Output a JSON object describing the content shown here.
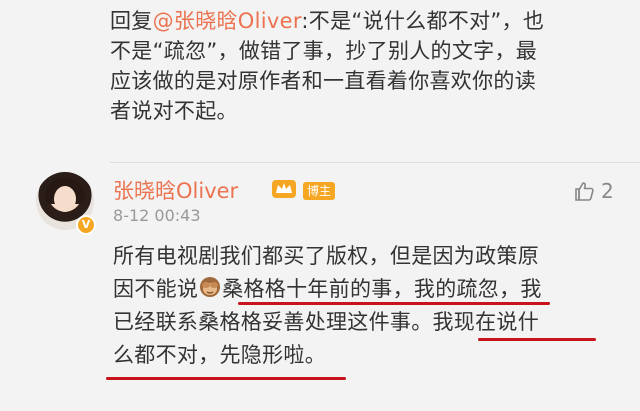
{
  "reply": {
    "prefix": "回复",
    "mention": "@张晓晗Oliver",
    "lines": [
      ":不是“说什么都不对”，也",
      "不是“疏忽”，做错了事，抄了别人的文字，最",
      "应该做的是对原作者和一直看着你喜欢你的读",
      "者说对不起。"
    ]
  },
  "comment": {
    "username": "张晓晗Oliver",
    "role_badge": "博主",
    "timestamp": "8-12 00:43",
    "like_count": "2",
    "lines": [
      "所有电视剧我们都买了版权，但是因为政策原",
      "因不能说",
      "桑格格十年前的事，我的疏忽，我",
      "已经联系桑格格妥善处理这件事。我现在说什",
      "么都不对，先隐形啦。"
    ]
  },
  "colors": {
    "accent": "#eb7350",
    "badge": "#f5a623",
    "underline": "#c8131d",
    "text": "#333333",
    "muted": "#999999"
  },
  "icons": {
    "crown": "crown-icon",
    "like": "thumbs-up-icon",
    "emoji": "see-no-evil-monkey-icon",
    "verified": "verified-v-icon"
  }
}
